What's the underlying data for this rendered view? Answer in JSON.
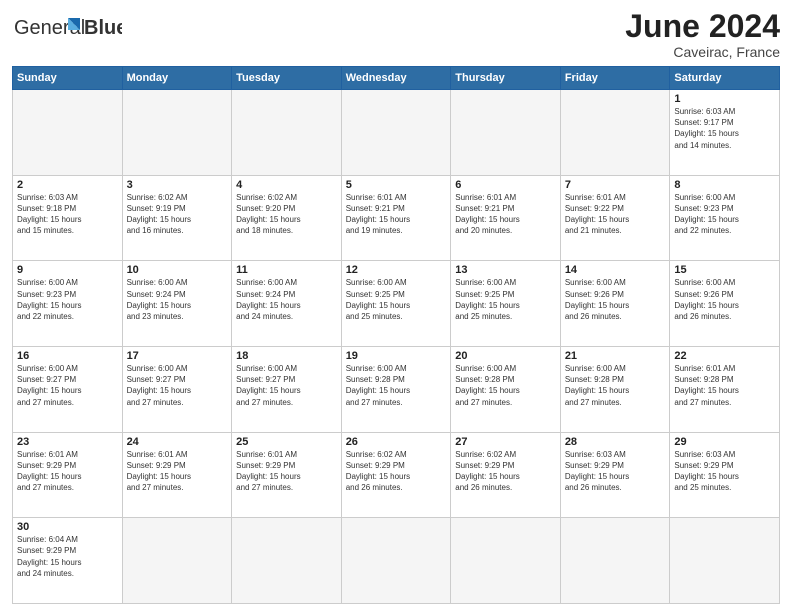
{
  "header": {
    "logo_text_regular": "General",
    "logo_text_bold": "Blue",
    "month_title": "June 2024",
    "location": "Caveirac, France"
  },
  "weekdays": [
    "Sunday",
    "Monday",
    "Tuesday",
    "Wednesday",
    "Thursday",
    "Friday",
    "Saturday"
  ],
  "weeks": [
    [
      {
        "day": "",
        "info": ""
      },
      {
        "day": "",
        "info": ""
      },
      {
        "day": "",
        "info": ""
      },
      {
        "day": "",
        "info": ""
      },
      {
        "day": "",
        "info": ""
      },
      {
        "day": "",
        "info": ""
      },
      {
        "day": "1",
        "info": "Sunrise: 6:03 AM\nSunset: 9:17 PM\nDaylight: 15 hours\nand 14 minutes."
      }
    ],
    [
      {
        "day": "2",
        "info": "Sunrise: 6:03 AM\nSunset: 9:18 PM\nDaylight: 15 hours\nand 15 minutes."
      },
      {
        "day": "3",
        "info": "Sunrise: 6:02 AM\nSunset: 9:19 PM\nDaylight: 15 hours\nand 16 minutes."
      },
      {
        "day": "4",
        "info": "Sunrise: 6:02 AM\nSunset: 9:20 PM\nDaylight: 15 hours\nand 18 minutes."
      },
      {
        "day": "5",
        "info": "Sunrise: 6:01 AM\nSunset: 9:21 PM\nDaylight: 15 hours\nand 19 minutes."
      },
      {
        "day": "6",
        "info": "Sunrise: 6:01 AM\nSunset: 9:21 PM\nDaylight: 15 hours\nand 20 minutes."
      },
      {
        "day": "7",
        "info": "Sunrise: 6:01 AM\nSunset: 9:22 PM\nDaylight: 15 hours\nand 21 minutes."
      },
      {
        "day": "8",
        "info": "Sunrise: 6:00 AM\nSunset: 9:23 PM\nDaylight: 15 hours\nand 22 minutes."
      }
    ],
    [
      {
        "day": "9",
        "info": "Sunrise: 6:00 AM\nSunset: 9:23 PM\nDaylight: 15 hours\nand 22 minutes."
      },
      {
        "day": "10",
        "info": "Sunrise: 6:00 AM\nSunset: 9:24 PM\nDaylight: 15 hours\nand 23 minutes."
      },
      {
        "day": "11",
        "info": "Sunrise: 6:00 AM\nSunset: 9:24 PM\nDaylight: 15 hours\nand 24 minutes."
      },
      {
        "day": "12",
        "info": "Sunrise: 6:00 AM\nSunset: 9:25 PM\nDaylight: 15 hours\nand 25 minutes."
      },
      {
        "day": "13",
        "info": "Sunrise: 6:00 AM\nSunset: 9:25 PM\nDaylight: 15 hours\nand 25 minutes."
      },
      {
        "day": "14",
        "info": "Sunrise: 6:00 AM\nSunset: 9:26 PM\nDaylight: 15 hours\nand 26 minutes."
      },
      {
        "day": "15",
        "info": "Sunrise: 6:00 AM\nSunset: 9:26 PM\nDaylight: 15 hours\nand 26 minutes."
      }
    ],
    [
      {
        "day": "16",
        "info": "Sunrise: 6:00 AM\nSunset: 9:27 PM\nDaylight: 15 hours\nand 27 minutes."
      },
      {
        "day": "17",
        "info": "Sunrise: 6:00 AM\nSunset: 9:27 PM\nDaylight: 15 hours\nand 27 minutes."
      },
      {
        "day": "18",
        "info": "Sunrise: 6:00 AM\nSunset: 9:27 PM\nDaylight: 15 hours\nand 27 minutes."
      },
      {
        "day": "19",
        "info": "Sunrise: 6:00 AM\nSunset: 9:28 PM\nDaylight: 15 hours\nand 27 minutes."
      },
      {
        "day": "20",
        "info": "Sunrise: 6:00 AM\nSunset: 9:28 PM\nDaylight: 15 hours\nand 27 minutes."
      },
      {
        "day": "21",
        "info": "Sunrise: 6:00 AM\nSunset: 9:28 PM\nDaylight: 15 hours\nand 27 minutes."
      },
      {
        "day": "22",
        "info": "Sunrise: 6:01 AM\nSunset: 9:28 PM\nDaylight: 15 hours\nand 27 minutes."
      }
    ],
    [
      {
        "day": "23",
        "info": "Sunrise: 6:01 AM\nSunset: 9:29 PM\nDaylight: 15 hours\nand 27 minutes."
      },
      {
        "day": "24",
        "info": "Sunrise: 6:01 AM\nSunset: 9:29 PM\nDaylight: 15 hours\nand 27 minutes."
      },
      {
        "day": "25",
        "info": "Sunrise: 6:01 AM\nSunset: 9:29 PM\nDaylight: 15 hours\nand 27 minutes."
      },
      {
        "day": "26",
        "info": "Sunrise: 6:02 AM\nSunset: 9:29 PM\nDaylight: 15 hours\nand 26 minutes."
      },
      {
        "day": "27",
        "info": "Sunrise: 6:02 AM\nSunset: 9:29 PM\nDaylight: 15 hours\nand 26 minutes."
      },
      {
        "day": "28",
        "info": "Sunrise: 6:03 AM\nSunset: 9:29 PM\nDaylight: 15 hours\nand 26 minutes."
      },
      {
        "day": "29",
        "info": "Sunrise: 6:03 AM\nSunset: 9:29 PM\nDaylight: 15 hours\nand 25 minutes."
      }
    ],
    [
      {
        "day": "30",
        "info": "Sunrise: 6:04 AM\nSunset: 9:29 PM\nDaylight: 15 hours\nand 24 minutes."
      },
      {
        "day": "",
        "info": ""
      },
      {
        "day": "",
        "info": ""
      },
      {
        "day": "",
        "info": ""
      },
      {
        "day": "",
        "info": ""
      },
      {
        "day": "",
        "info": ""
      },
      {
        "day": "",
        "info": ""
      }
    ]
  ]
}
